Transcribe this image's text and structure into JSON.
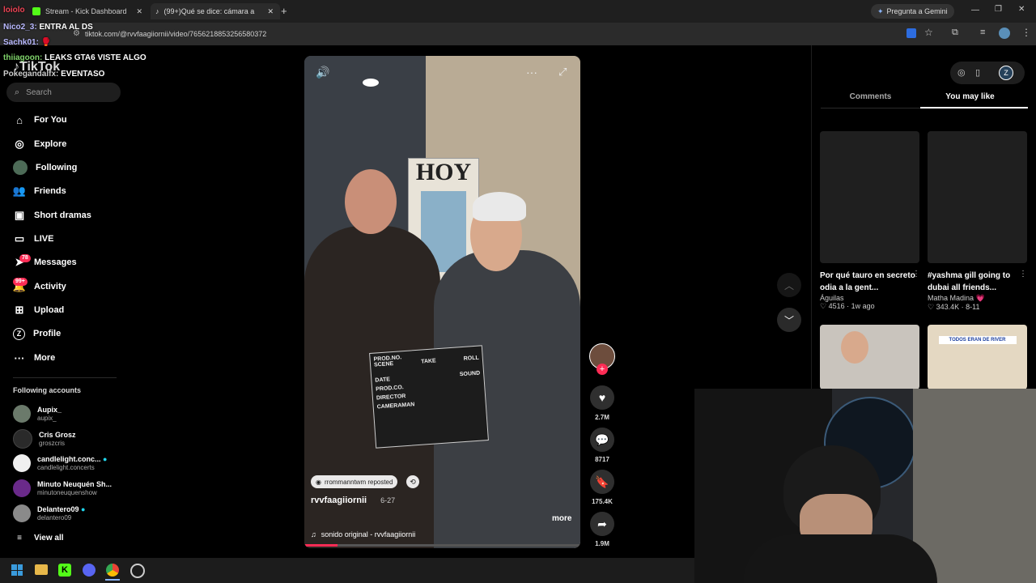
{
  "browser": {
    "tabs": [
      {
        "label": "Stream - Kick Dashboard",
        "active": false
      },
      {
        "label": "(99+)Qué se dice: cámara a",
        "active": true
      }
    ],
    "gemini_label": "Pregunta a Gemini",
    "url": "tiktok.com/@rvvfaagiiornii/video/7656218853256580372"
  },
  "chat_overlay": [
    {
      "user": "loiolo",
      "text": ""
    },
    {
      "user": "Nico2_3:",
      "text": "ENTRA AL DS"
    },
    {
      "user": "Sachk01:",
      "text": "🥊"
    },
    {
      "user": "thiiagoon:",
      "text": "LEAKS GTA6 VISTE ALGO"
    },
    {
      "user": "Pokegandalfx:",
      "text": "EVENTASO"
    }
  ],
  "sidebar": {
    "logo": "TikTok",
    "search_placeholder": "Search",
    "items": [
      {
        "label": "For You",
        "icon": "home-icon"
      },
      {
        "label": "Explore",
        "icon": "compass-icon"
      },
      {
        "label": "Following",
        "icon": "following-avatar-icon"
      },
      {
        "label": "Friends",
        "icon": "friends-icon"
      },
      {
        "label": "Short dramas",
        "icon": "film-icon"
      },
      {
        "label": "LIVE",
        "icon": "live-icon"
      },
      {
        "label": "Messages",
        "icon": "send-icon",
        "badge": "78"
      },
      {
        "label": "Activity",
        "icon": "bell-icon",
        "badge": "99+"
      },
      {
        "label": "Upload",
        "icon": "plus-square-icon"
      },
      {
        "label": "Profile",
        "icon": "profile-icon"
      },
      {
        "label": "More",
        "icon": "more-icon"
      }
    ],
    "following_title": "Following accounts",
    "accounts": [
      {
        "name": "Aupix_",
        "handle": "aupix_",
        "color": "#6b7a6b",
        "verified": false
      },
      {
        "name": "Cris Grosz",
        "handle": "groszcris",
        "color": "#2a2a2a",
        "verified": false
      },
      {
        "name": "candlelight.conc...",
        "handle": "candlelight.concerts",
        "color": "#f0f0f0",
        "verified": true
      },
      {
        "name": "Minuto Neuquén Sh...",
        "handle": "minutoneuquenshow",
        "color": "#6a2a8a",
        "verified": false
      },
      {
        "name": "Delantero09",
        "handle": "delantero09",
        "color": "#8a8a8a",
        "verified": true
      }
    ],
    "view_all": "View all"
  },
  "video": {
    "sign_text": "HOY",
    "repost_label": "rrommanntwm reposted",
    "author": "rvvfaagiiornii",
    "date": "6-27",
    "more": "more",
    "sound": "sonido original - rvvfaagiiornii",
    "clapper_lines": [
      "PROD.NO.",
      "SCENE",
      "TAKE",
      "ROLL",
      "DATE",
      "SOUND",
      "PROD.CO.",
      "DIRECTOR",
      "CAMERAMAN"
    ]
  },
  "actions": {
    "likes": "2.7M",
    "comments": "8717",
    "saves": "175.4K",
    "shares": "1.9M"
  },
  "right_panel": {
    "tabs": [
      "Comments",
      "You may like"
    ],
    "active_tab": "You may like",
    "cards": [
      {
        "title": "Por qué tauro en secreto odia a la gent...",
        "author": "Águilas",
        "likes": "4516",
        "date": "1w ago"
      },
      {
        "title": "#yashma gill going to dubai all friends...",
        "author": "Matha Madina 💗",
        "likes": "343.4K",
        "date": "8-11"
      }
    ],
    "thumb_text": "TODOS ERAN DE RIVER"
  },
  "colors": {
    "accent": "#fe2c55",
    "bg": "#000000",
    "chrome": "#1f1f1f"
  }
}
